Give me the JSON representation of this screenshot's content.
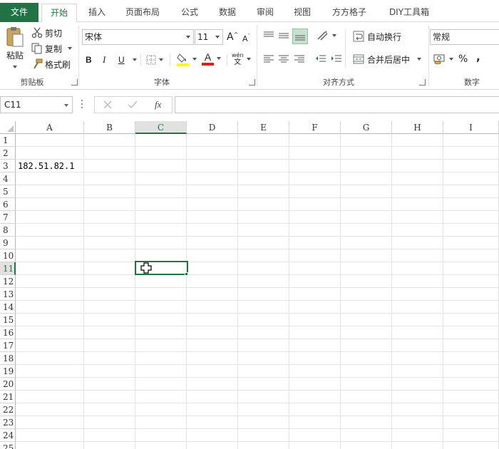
{
  "tabs": {
    "file": "文件",
    "home": "开始",
    "insert": "插入",
    "page_layout": "页面布局",
    "formulas": "公式",
    "data": "数据",
    "review": "审阅",
    "view": "视图",
    "ffgz": "方方格子",
    "diy": "DIY工具箱"
  },
  "clipboard": {
    "paste": "粘贴",
    "cut": "剪切",
    "copy": "复制",
    "format_painter": "格式刷",
    "label": "剪贴板"
  },
  "font": {
    "name": "宋体",
    "size": "11",
    "grow": "A",
    "shrink": "A",
    "bold": "B",
    "italic": "I",
    "underline": "U",
    "font_color_glyph": "A",
    "phonetic": "wén",
    "phonetic_sub": "文",
    "label": "字体"
  },
  "alignment": {
    "wrap_text": "自动换行",
    "merge_center": "合并后居中",
    "label": "对齐方式"
  },
  "number": {
    "format": "常规",
    "percent": "%",
    "comma": ",",
    "label": "数字"
  },
  "formula_bar": {
    "name_box": "C11",
    "fx": "fx"
  },
  "grid": {
    "columns": [
      "A",
      "B",
      "C",
      "D",
      "E",
      "F",
      "G",
      "H",
      "I"
    ],
    "selected_column": "C",
    "rows": [
      "1",
      "2",
      "3",
      "4",
      "5",
      "6",
      "7",
      "8",
      "9",
      "10",
      "11",
      "12",
      "13",
      "14",
      "15",
      "16",
      "17",
      "18",
      "19",
      "20",
      "21",
      "22",
      "23",
      "24",
      "25"
    ],
    "selected_row": "11",
    "cells": {
      "A3": "182.51.82.1"
    }
  },
  "colors": {
    "accent": "#217346",
    "font_color_bar": "#e31b1b",
    "fill_color_bar": "#ffff00"
  }
}
